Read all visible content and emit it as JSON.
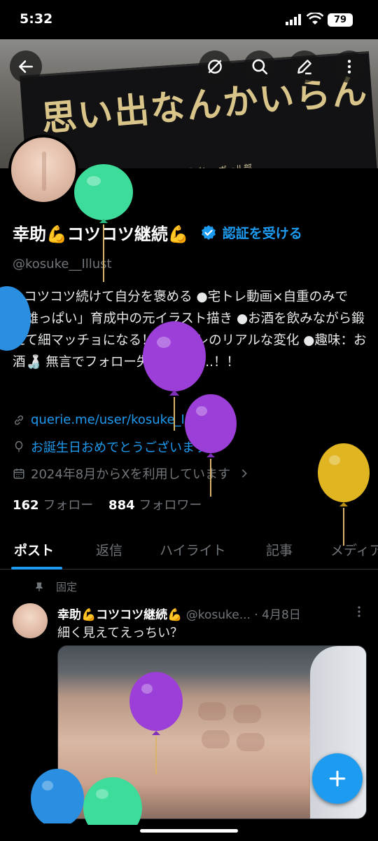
{
  "status_bar": {
    "time": "5:32",
    "battery": "79"
  },
  "banner": {
    "slogan": "思い出なんかいらん",
    "subtext": "梅丘崎 高校男子バレーボール部"
  },
  "profile": {
    "display_name": "幸助💪コツコツ継続💪",
    "verify_label": "認証を受ける",
    "handle": "@kosuke__Illust",
    "bio": "●コツコツ続けて自分を褒める ●宅トレ動画×自重のみで「雄っぱい」育成中の元イラスト描き ●お酒を飲みながら鍛えて細マッチョになる！ ●家トレのリアルな変化 ●趣味：お酒🍶 無言でフォロー失礼します...！！",
    "link": "querie.me/user/kosuke_I...",
    "birthday": "お誕生日おめでとうございます。",
    "joined": "2024年8月からXを利用しています",
    "following_count": "162",
    "following_label": "フォロー",
    "followers_count": "884",
    "followers_label": "フォロワー"
  },
  "tabs": [
    "ポスト",
    "返信",
    "ハイライト",
    "記事",
    "メディア"
  ],
  "post": {
    "pinned_label": "固定",
    "author": "幸助💪コツコツ継続💪",
    "handle": "@kosuke...",
    "date": "· 4月8日",
    "text": "細く見えてえっちい？"
  },
  "colors": {
    "accent": "#1d9bf0",
    "background": "#000000",
    "balloon_green": "#3ddc9a",
    "balloon_purple": "#9b3fd8",
    "balloon_blue": "#2a8fe0",
    "balloon_gold": "#e0b521"
  },
  "icons": [
    "back-arrow-icon",
    "grok-icon",
    "search-icon",
    "edit-icon",
    "more-vertical-icon",
    "verified-badge-icon",
    "link-icon",
    "balloon-birthday-icon",
    "calendar-icon",
    "chevron-right-icon",
    "pin-icon",
    "plus-icon"
  ]
}
